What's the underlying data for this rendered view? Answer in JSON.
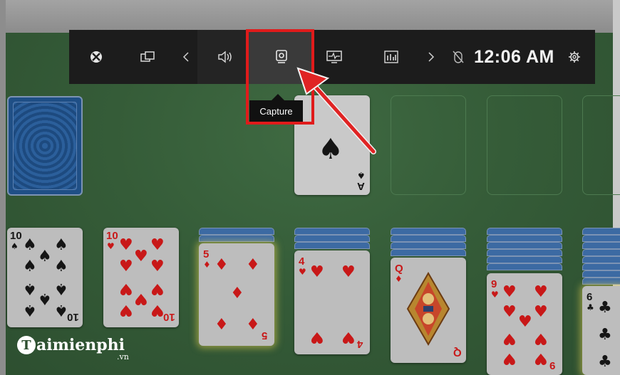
{
  "game_bar": {
    "clock": "12:06 AM",
    "tooltip": "Capture",
    "items": [
      "xbox-icon",
      "widgets-icon",
      "chevron-left-icon",
      "audio-icon",
      "capture-icon",
      "performance-icon",
      "resources-icon",
      "chevron-right-icon",
      "mouse-off-icon",
      "settings-icon"
    ]
  },
  "foundation": {
    "ace_rank": "A"
  },
  "tableau": [
    {
      "rank": "10",
      "suit": "♠",
      "color": "black"
    },
    {
      "rank": "10",
      "suit": "♥",
      "color": "red"
    },
    {
      "rank": "5",
      "suit": "♦",
      "color": "red"
    },
    {
      "rank": "4",
      "suit": "♥",
      "color": "red"
    },
    {
      "rank": "Q",
      "suit": "♦",
      "color": "red"
    },
    {
      "rank": "9",
      "suit": "♥",
      "color": "red"
    },
    {
      "rank": "6",
      "suit": "♣",
      "color": "black"
    }
  ],
  "watermark": {
    "brand": "aimienphi",
    "tld": ".vn"
  },
  "colors": {
    "highlight": "#e01b1b",
    "felt": "#355c38",
    "bar": "#1c1c1c"
  }
}
